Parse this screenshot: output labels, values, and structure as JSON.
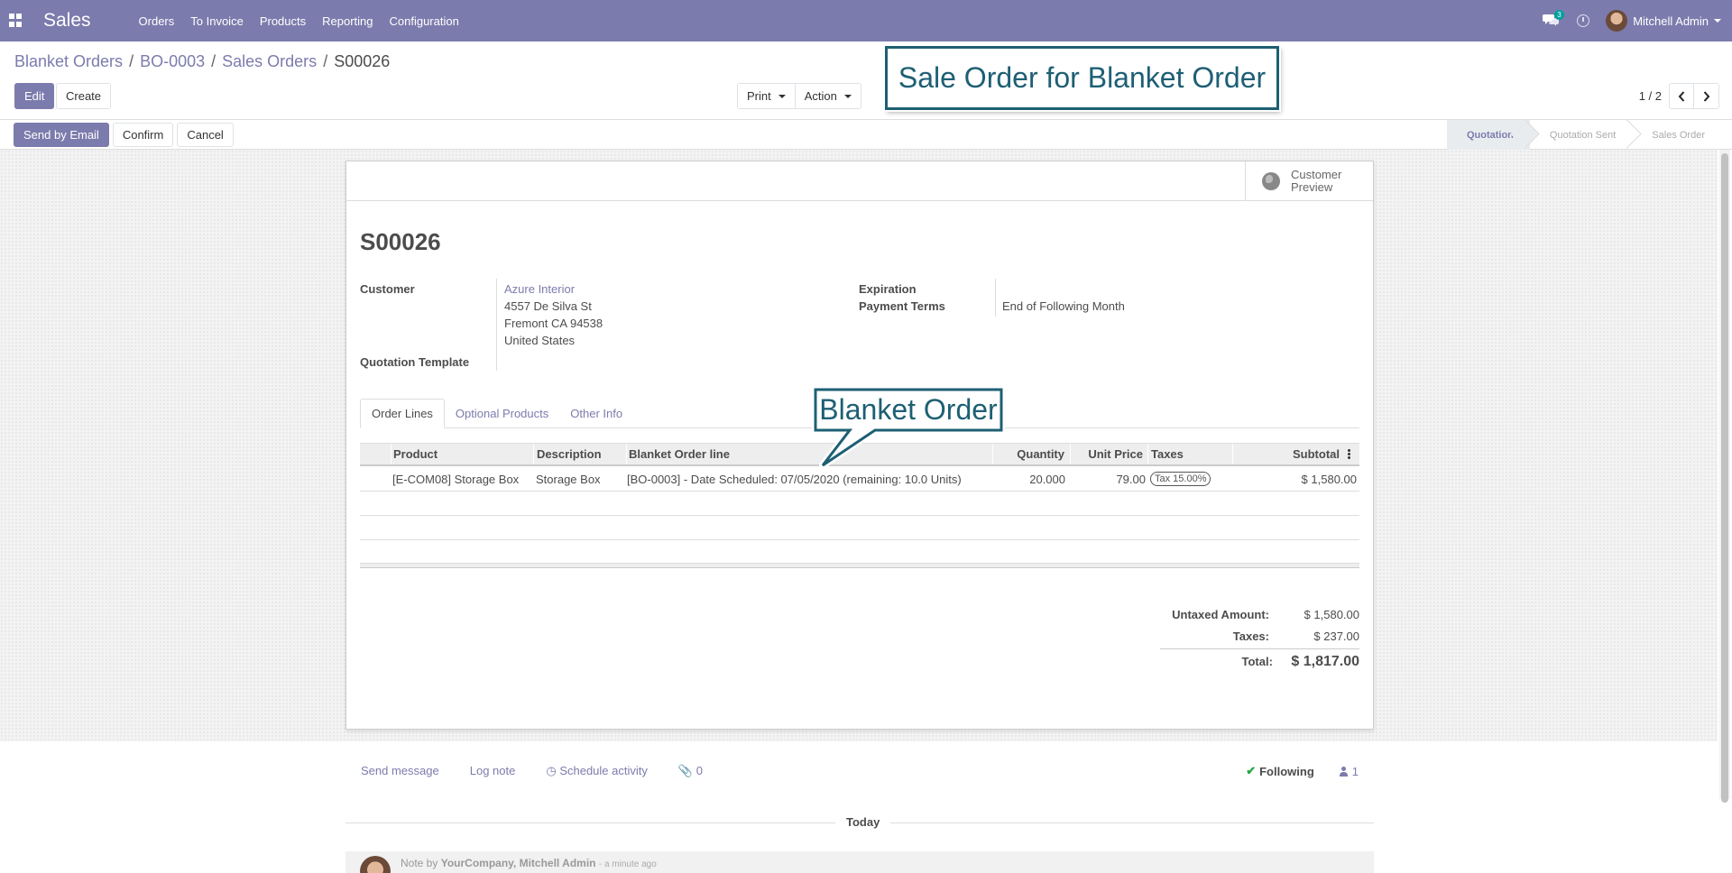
{
  "navbar": {
    "app_name": "Sales",
    "menu": [
      "Orders",
      "To Invoice",
      "Products",
      "Reporting",
      "Configuration"
    ],
    "chat_count": "3",
    "user_name": "Mitchell Admin"
  },
  "breadcrumb": [
    "Blanket Orders",
    "BO-0003",
    "Sales Orders",
    "S00026"
  ],
  "buttons": {
    "edit": "Edit",
    "create": "Create",
    "print": "Print",
    "action": "Action",
    "send_email": "Send by Email",
    "confirm": "Confirm",
    "cancel": "Cancel"
  },
  "pager": {
    "value": "1 / 2"
  },
  "callouts": {
    "title": "Sale Order for Blanket Order",
    "blanket": "Blanket Order"
  },
  "stages": [
    "Quotation",
    "Quotation Sent",
    "Sales Order"
  ],
  "active_stage": "Quotation",
  "sheet": {
    "preview_label_1": "Customer",
    "preview_label_2": "Preview",
    "title": "S00026",
    "customer_label": "Customer",
    "customer_name": "Azure Interior",
    "address_1": "4557 De Silva St",
    "address_2": "Fremont CA 94538",
    "address_3": "United States",
    "template_label": "Quotation Template",
    "expiration_label": "Expiration",
    "payment_terms_label": "Payment Terms",
    "payment_terms_value": "End of Following Month"
  },
  "tabs": [
    "Order Lines",
    "Optional Products",
    "Other Info"
  ],
  "order_table": {
    "columns": [
      "Product",
      "Description",
      "Blanket Order line",
      "Quantity",
      "Unit Price",
      "Taxes",
      "Subtotal"
    ],
    "rows": [
      {
        "product": "[E-COM08] Storage Box",
        "description": "Storage Box",
        "blanket_line": "[BO-0003] - Date Scheduled: 07/05/2020 (remaining: 10.0 Units)",
        "quantity": "20.000",
        "unit_price": "79.00",
        "taxes": "Tax 15.00%",
        "subtotal": "$ 1,580.00"
      }
    ]
  },
  "totals": {
    "untaxed_label": "Untaxed Amount:",
    "untaxed_value": "$ 1,580.00",
    "taxes_label": "Taxes:",
    "taxes_value": "$ 237.00",
    "total_label": "Total:",
    "total_value": "$ 1,817.00"
  },
  "chatter": {
    "send_message": "Send message",
    "log_note": "Log note",
    "schedule_activity": "Schedule activity",
    "attachments": "0",
    "following": "Following",
    "followers": "1",
    "today": "Today",
    "note_prefix": "Note by",
    "note_author": "YourCompany, Mitchell Admin",
    "note_time": "- a minute ago"
  },
  "colors": {
    "brand": "#7c7bad",
    "callout": "#1e5f74"
  }
}
